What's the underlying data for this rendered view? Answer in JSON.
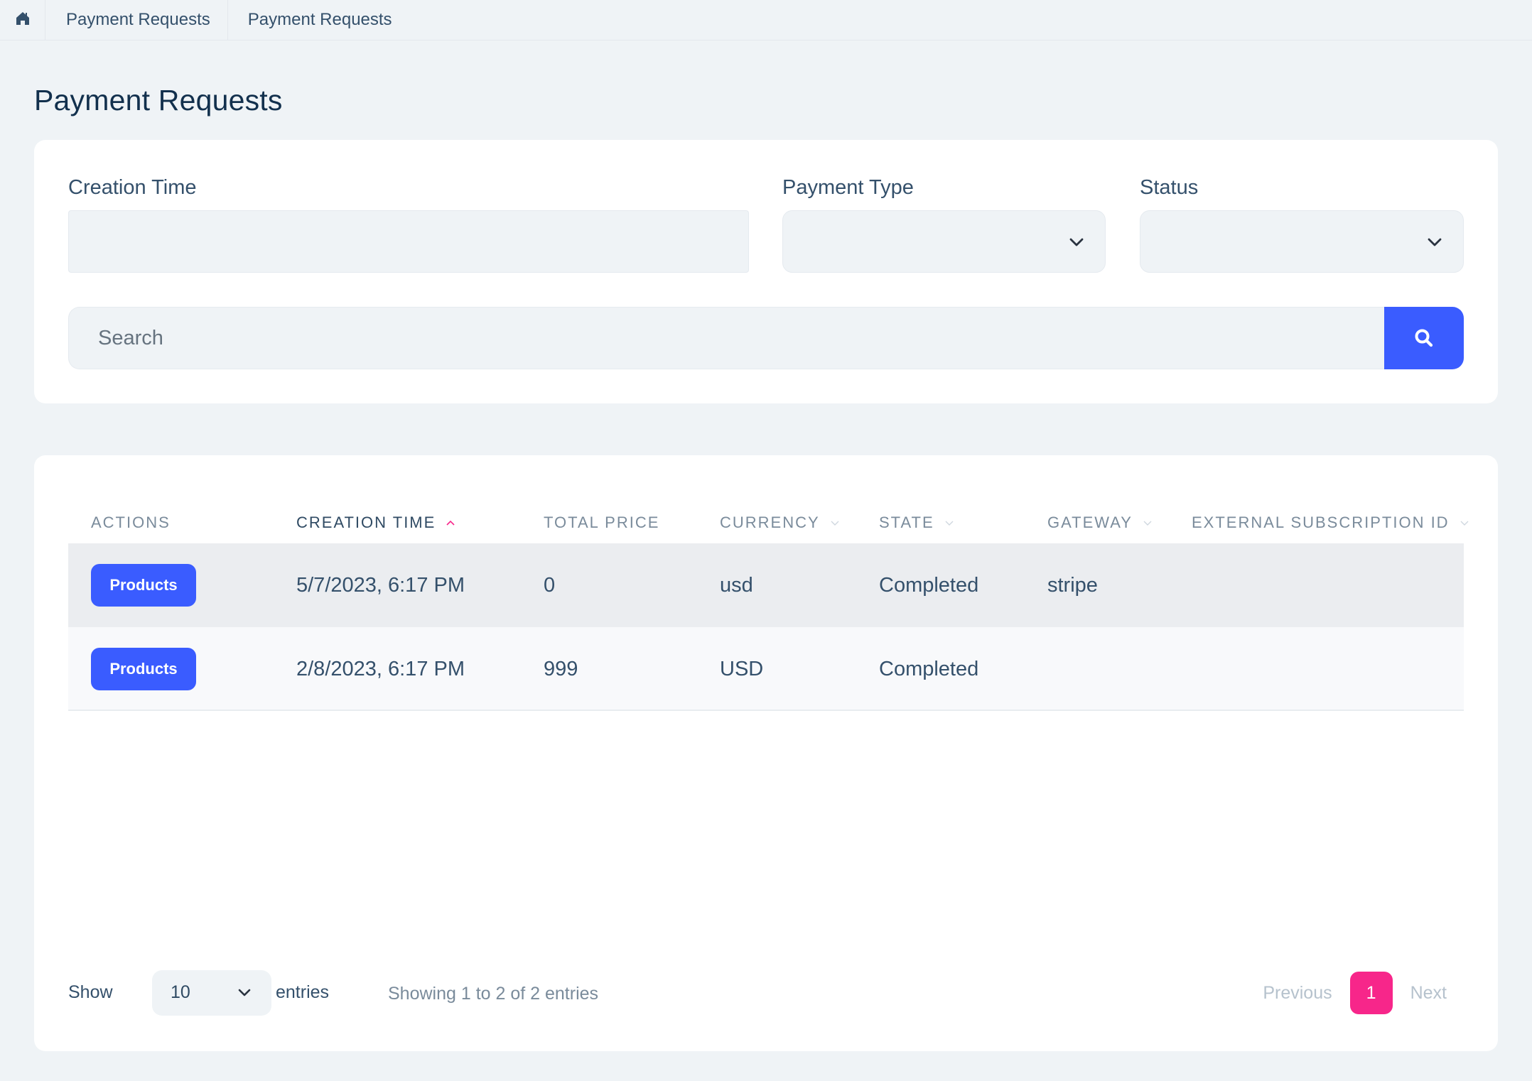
{
  "breadcrumb": {
    "home_icon": "home-icon",
    "items": [
      "Payment Requests",
      "Payment Requests"
    ]
  },
  "page": {
    "title": "Payment Requests"
  },
  "filters": {
    "creation_time": {
      "label": "Creation Time",
      "value": ""
    },
    "payment_type": {
      "label": "Payment Type",
      "value": "",
      "icon": "chevron-down-icon"
    },
    "status": {
      "label": "Status",
      "value": "",
      "icon": "chevron-down-icon"
    },
    "search": {
      "placeholder": "Search",
      "value": "",
      "button_icon": "search-icon"
    }
  },
  "table": {
    "columns": [
      {
        "label": "ACTIONS",
        "sort": "none"
      },
      {
        "label": "CREATION TIME",
        "sort": "asc"
      },
      {
        "label": "TOTAL PRICE",
        "sort": "none"
      },
      {
        "label": "CURRENCY",
        "sort": "sortable"
      },
      {
        "label": "STATE",
        "sort": "sortable"
      },
      {
        "label": "GATEWAY",
        "sort": "sortable"
      },
      {
        "label": "EXTERNAL SUBSCRIPTION ID",
        "sort": "sortable"
      }
    ],
    "rows": [
      {
        "action": "Products",
        "creation_time": "5/7/2023, 6:17 PM",
        "total_price": "0",
        "currency": "usd",
        "state": "Completed",
        "gateway": "stripe",
        "external_subscription_id": ""
      },
      {
        "action": "Products",
        "creation_time": "2/8/2023, 6:17 PM",
        "total_price": "999",
        "currency": "USD",
        "state": "Completed",
        "gateway": "",
        "external_subscription_id": ""
      }
    ]
  },
  "footer": {
    "show_label": "Show",
    "page_length": "10",
    "entries_label": "entries",
    "info": "Showing 1 to 2 of 2 entries",
    "pagination": {
      "previous": "Previous",
      "current": "1",
      "next": "Next"
    }
  },
  "colors": {
    "accent": "#3a5cff",
    "active_page": "#f7268a",
    "sort_active": "#f7268a",
    "background": "#eff3f6",
    "text": "#2f4a63"
  }
}
